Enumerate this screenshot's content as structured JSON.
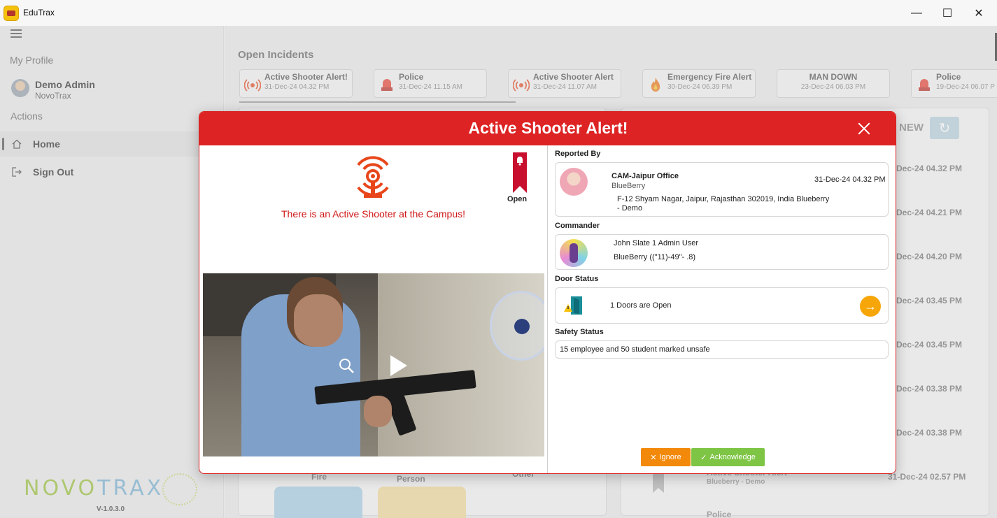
{
  "window": {
    "title": "EduTrax",
    "minimize": "—",
    "maximize": "☐",
    "close": "✕"
  },
  "sidebar": {
    "my_profile_heading": "My Profile",
    "user_name": "Demo Admin",
    "user_org": "NovoTrax",
    "actions_heading": "Actions",
    "nav": [
      {
        "label": "Home",
        "icon": "home-icon"
      },
      {
        "label": "Sign Out",
        "icon": "sign-out-icon"
      }
    ],
    "brand": {
      "left": "NOVO",
      "right": "TRAX"
    },
    "version": "V-1.0.3.0"
  },
  "main": {
    "title": "Open Incidents",
    "incidents": [
      {
        "title": "Active Shooter Alert!",
        "date": "31-Dec-24 04.32 PM",
        "icon": "alarm-icon"
      },
      {
        "title": "Police",
        "date": "31-Dec-24 11.15 AM",
        "icon": "police-siren-icon"
      },
      {
        "title": "Active Shooter Alert",
        "date": "31-Dec-24 11.07 AM",
        "icon": "alarm-icon"
      },
      {
        "title": "Emergency Fire Alert",
        "date": "30-Dec-24 06.39 PM",
        "icon": "fire-icon"
      },
      {
        "title": "MAN DOWN",
        "date": "23-Dec-24 06.03 PM",
        "icon": ""
      },
      {
        "title": "Police",
        "date": "19-Dec-24 06.07 P",
        "icon": "police-siren-icon"
      }
    ],
    "new_label": "NEW",
    "list_times": [
      "-Dec-24 04.32 PM",
      "-Dec-24 04.21 PM",
      "-Dec-24 04.20 PM",
      "-Dec-24 03.45 PM",
      "-Dec-24 03.45 PM",
      "-Dec-24 03.38 PM",
      "-Dec-24 03.38 PM"
    ],
    "bottom_labels": {
      "fire": "Fire",
      "person": "Person",
      "other": "Other"
    },
    "last_item": {
      "title": "Active Shooter Alert",
      "sub": "Blueberry - Demo",
      "time": "31-Dec-24 02.57 PM",
      "next": "Police"
    }
  },
  "modal": {
    "title": "Active Shooter Alert!",
    "status": "Open",
    "message": "There is an Active Shooter at the Campus!",
    "reported_by_label": "Reported By",
    "reporter": {
      "name": "CAM-Jaipur Office",
      "org": "BlueBerry",
      "time": "31-Dec-24 04.32 PM",
      "address_line1": "F-12 Shyam Nagar, Jaipur, Rajasthan 302019, India Blueberry",
      "address_line2": "- Demo"
    },
    "commander_label": "Commander",
    "commander": {
      "name": "John Slate 1 Admin User",
      "contact": "BlueBerry ((\"11)-49\"-  .8)"
    },
    "door_status_label": "Door Status",
    "door_status_text": "1 Doors are Open",
    "safety_status_label": "Safety Status",
    "safety_status_text": "15 employee  and 50 student marked unsafe",
    "ignore_label": "Ignore",
    "acknowledge_label": "Acknowledge"
  },
  "colors": {
    "header_red": "#dd2323",
    "alert_text": "#d01818",
    "ignore": "#f3890a",
    "acknowledge": "#7ec545",
    "door_go": "#f6a609"
  }
}
